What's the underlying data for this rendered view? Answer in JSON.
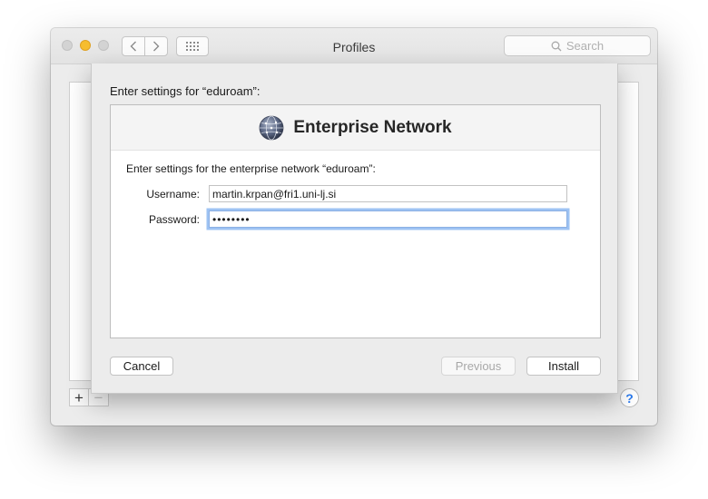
{
  "window": {
    "title": "Profiles",
    "search_placeholder": "Search",
    "plus_label": "+",
    "minus_label": "−",
    "help_label": "?"
  },
  "sheet": {
    "heading": "Enter settings for “eduroam”:",
    "banner_title": "Enterprise Network",
    "instructions": "Enter settings for the enterprise network “eduroam”:",
    "username_label": "Username:",
    "username_value": "martin.krpan@fri1.uni-lj.si",
    "password_label": "Password:",
    "password_value": "••••••••",
    "buttons": {
      "cancel": "Cancel",
      "previous": "Previous",
      "install": "Install"
    }
  },
  "icons": {
    "banner": "network-globe-icon",
    "search": "search-icon",
    "back": "chevron-left-icon",
    "forward": "chevron-right-icon",
    "grid": "grid-icon"
  },
  "colors": {
    "accent": "#2b7bf0",
    "focus_ring": "#9ec3f3",
    "minimize": "#f6bd2f"
  }
}
